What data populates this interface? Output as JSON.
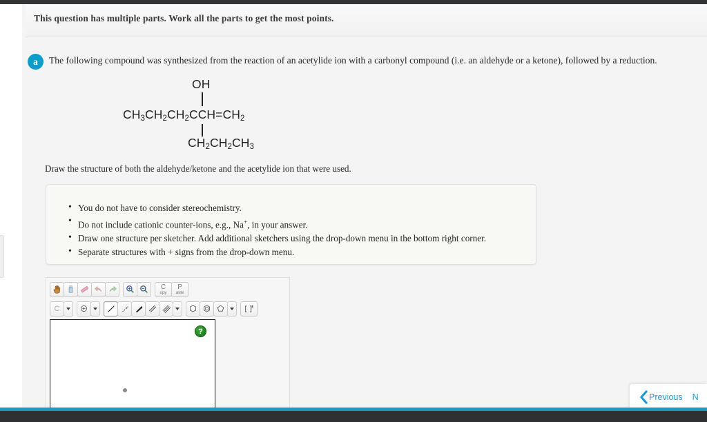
{
  "banner": {
    "notice": "This question has multiple parts. Work all the parts to get the most points."
  },
  "question": {
    "part_label": "a",
    "prompt": "The following compound was synthesized from the reaction of an acetylide ion with a carbonyl compound (i.e. an aldehyde or a ketone), followed by a reduction.",
    "instruction": "Draw the structure of both the aldehyde/ketone and the acetylide ion that were used.",
    "structure": {
      "substituent_top": "OH",
      "main_chain": "CH3CH2CH2CCH=CH2",
      "substituent_bottom": "CH2CH2CH3"
    },
    "notes": [
      "You do not have to consider stereochemistry.",
      "Do not include cationic counter-ions, e.g., Na⁺, in your answer.",
      "Draw one structure per sketcher. Add additional sketchers using the drop-down menu in the bottom right corner.",
      "Separate structures with + signs from the drop-down menu."
    ]
  },
  "sketcher": {
    "toolbar_row1": [
      {
        "name": "pan-hand-tool",
        "title": "Pan"
      },
      {
        "name": "eraser-tool",
        "title": "Erase"
      },
      {
        "name": "clean-structure-tool",
        "title": "Clean"
      },
      {
        "name": "undo-tool",
        "title": "Undo"
      },
      {
        "name": "redo-tool",
        "title": "Redo"
      },
      {
        "name": "zoom-in-tool",
        "title": "Zoom In"
      },
      {
        "name": "zoom-out-tool",
        "title": "Zoom Out"
      },
      {
        "name": "copy-tool",
        "title": "Copy",
        "line1": "C",
        "line2": "opy"
      },
      {
        "name": "paste-tool",
        "title": "Paste",
        "line1": "P",
        "line2": "aste"
      }
    ],
    "element_button_label": "C",
    "toolbar_row2": [
      {
        "name": "charge-tool",
        "title": "Charge"
      },
      {
        "name": "single-bond-tool",
        "title": "Single Bond",
        "selected": true
      },
      {
        "name": "hash-bond-tool",
        "title": "Hashed Bond"
      },
      {
        "name": "wedge-bond-tool",
        "title": "Wedge Bond"
      },
      {
        "name": "double-bond-tool",
        "title": "Double Bond"
      },
      {
        "name": "triple-bond-tool",
        "title": "Triple Bond"
      },
      {
        "name": "cyclohexane-ring-tool",
        "title": "Cyclohexane"
      },
      {
        "name": "benzene-ring-tool",
        "title": "Benzene"
      },
      {
        "name": "cyclopentane-ring-tool",
        "title": "Cyclopentane"
      },
      {
        "name": "bracket-charge-tool",
        "title": "Bracket"
      }
    ],
    "help_label": "?"
  },
  "navigation": {
    "previous_label": "Previous",
    "next_label": "Next"
  },
  "colors": {
    "accent_blue": "#1b9ad4",
    "badge_teal": "#0d9dc8",
    "help_green": "#137513"
  }
}
